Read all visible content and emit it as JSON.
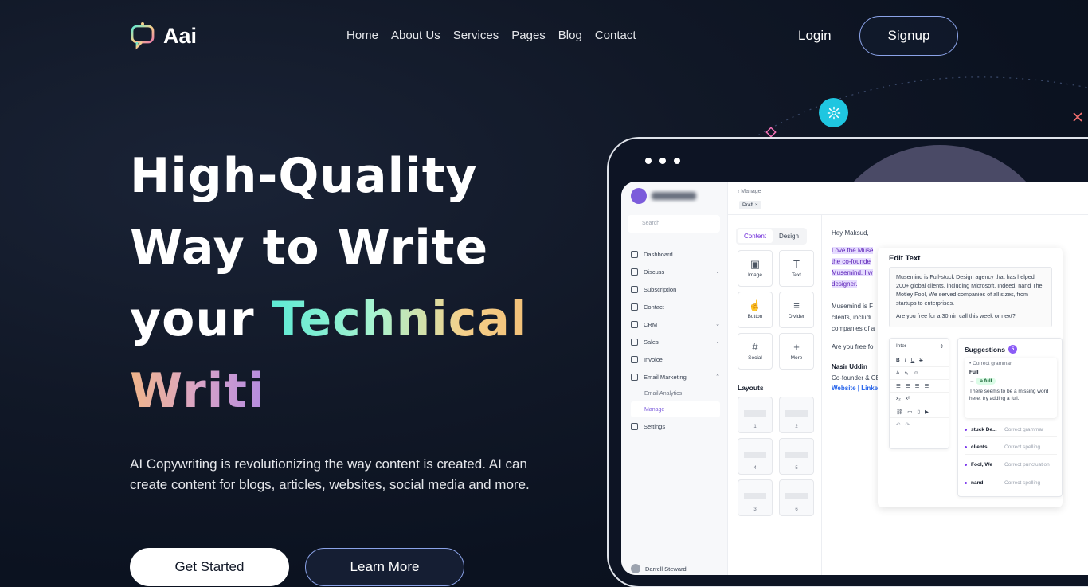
{
  "brand": {
    "name": "Aai",
    "accent": "#1fc6e0"
  },
  "nav": {
    "items": [
      "Home",
      "About Us",
      "Services",
      "Pages",
      "Blog",
      "Contact"
    ],
    "login_label": "Login",
    "signup_label": "Signup"
  },
  "hero": {
    "line1": "High-Quality",
    "line2": "Way to Write",
    "line3_plain": "your ",
    "line3_accent": "Technical",
    "line4_accent": "Writi",
    "description": "AI Copywriting is revolutionizing the way content is created. AI can create content for blogs, articles, websites, social media and more.",
    "cta_primary": "Get Started",
    "cta_secondary": "Learn More"
  },
  "mockup": {
    "sidebar": {
      "search_placeholder": "Search",
      "items": [
        {
          "label": "Dashboard",
          "chevron": false
        },
        {
          "label": "Discuss",
          "chevron": true
        },
        {
          "label": "Subscription",
          "chevron": false
        },
        {
          "label": "Contact",
          "chevron": false
        },
        {
          "label": "CRM",
          "chevron": true
        },
        {
          "label": "Sales",
          "chevron": true
        },
        {
          "label": "Invoice",
          "chevron": false
        },
        {
          "label": "Email Marketing",
          "chevron": true
        }
      ],
      "subitems": [
        "Email Analytics",
        "Manage"
      ],
      "settings_label": "Settings",
      "user_name": "Darrell Steward"
    },
    "crumb": "Manage",
    "draft_tag": "Draft",
    "tabs": [
      "Content",
      "Design"
    ],
    "blocks": [
      "Image",
      "Text",
      "Button",
      "Divider",
      "Social",
      "More"
    ],
    "layouts_label": "Layouts",
    "layouts": [
      "1",
      "2",
      "4",
      "5",
      "3",
      "6"
    ],
    "email": {
      "greeting": "Hey Maksud,",
      "hl1": "Love the Muse",
      "hl2": "the co-founde",
      "hl3": "Musemind. I w",
      "hl4": "designer.",
      "p2a": "Musemind is F",
      "p2b": "cilents, includi",
      "p2c": "companies of a",
      "p3": "Are you free fo",
      "sig_name": "Nasir Uddin",
      "sig_role": "Co-founder & CE",
      "sig_links": "Website | Linked"
    },
    "edit_text": {
      "title": "Edit Text",
      "body": "Musemind is Full-stuck Design agency that has helped 200+ global cilents, including Microsoft, Indeed, nand The Motley Fool, We served companies of all sizes, from startups to enterprises.",
      "question": "Are you free for a 30min call this week or next?"
    },
    "toolbar_font": "Inter",
    "suggestions": {
      "title": "Suggestions",
      "count": "5",
      "main_type": "Correct grammar",
      "main_word": "Full",
      "main_fix": "a full",
      "main_note": "There seems to be a missing word here. try adding a full.",
      "rows": [
        {
          "word": "stuck De...",
          "type": "Correct grammar"
        },
        {
          "word": "clients,",
          "type": "Correct spelling"
        },
        {
          "word": "Fool, We",
          "type": "Correct punctuation"
        },
        {
          "word": "nand",
          "type": "Correct spelling"
        }
      ]
    }
  }
}
